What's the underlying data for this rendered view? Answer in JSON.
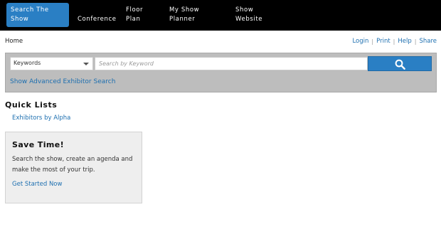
{
  "nav": {
    "items": [
      {
        "line1": "Search The",
        "line2": "Show"
      },
      {
        "line1": "Conference",
        "line2": ""
      },
      {
        "line1": "Floor",
        "line2": "Plan"
      },
      {
        "line1": "My Show",
        "line2": "Planner"
      },
      {
        "line1": "Show",
        "line2": "Website"
      }
    ],
    "active_color": "#2a7fc4",
    "background": "#000000"
  },
  "breadcrumb": {
    "home": "Home"
  },
  "utility_links": {
    "login": "Login",
    "print": "Print",
    "help": "Help",
    "share": "Share",
    "separator": "|"
  },
  "search": {
    "select_value": "Keywords",
    "input_placeholder": "Search by Keyword",
    "button_icon": "search-icon",
    "advanced_link": "Show Advanced Exhibitor Search"
  },
  "quick_lists": {
    "title": "Quick Lists",
    "items": [
      {
        "label": "Exhibitors by Alpha"
      }
    ]
  },
  "promo": {
    "title": "Save Time!",
    "text": "Search the show, create an agenda and make the most of your trip.",
    "link": "Get Started Now"
  },
  "colors": {
    "link": "#1d6fb0",
    "accent": "#2a7fc4",
    "searchbar_bg": "#bdbdbd",
    "promo_bg": "#eeeeee"
  }
}
